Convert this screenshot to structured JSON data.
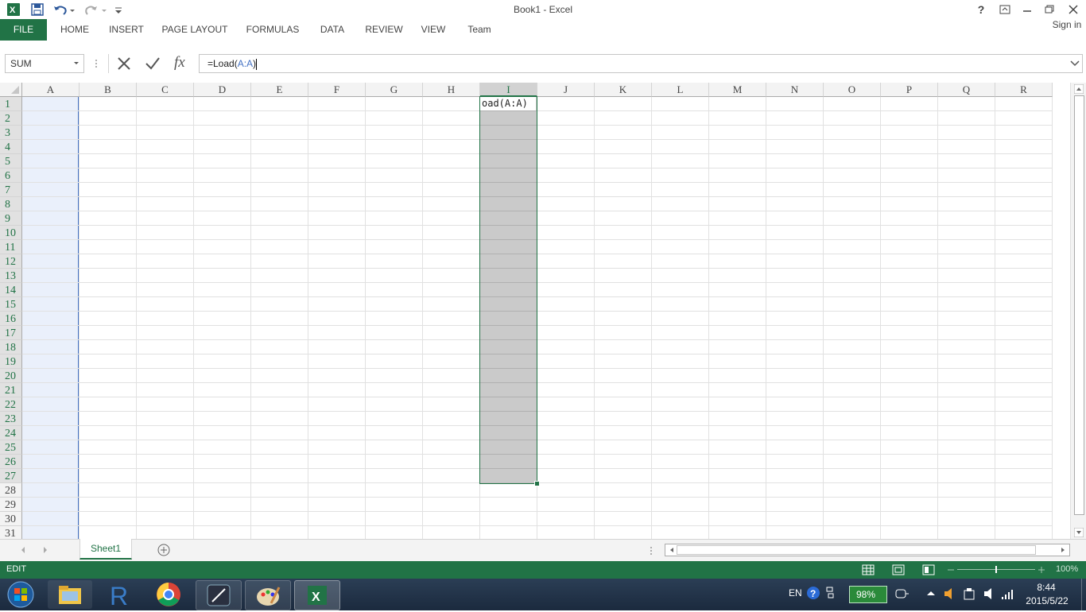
{
  "window": {
    "title": "Book1 - Excel",
    "help_label": "?",
    "sign_in": "Sign in"
  },
  "ribbon": {
    "tabs": [
      "FILE",
      "HOME",
      "INSERT",
      "PAGE LAYOUT",
      "FORMULAS",
      "DATA",
      "REVIEW",
      "VIEW",
      "Team"
    ]
  },
  "formula_bar": {
    "name_box": "SUM",
    "fx_label": "fx",
    "formula_prefix": "=Load(",
    "formula_ref": "A:A",
    "formula_suffix": ")"
  },
  "grid": {
    "columns": [
      "A",
      "B",
      "C",
      "D",
      "E",
      "F",
      "G",
      "H",
      "I",
      "J",
      "K",
      "L",
      "M",
      "N",
      "O",
      "P",
      "Q",
      "R"
    ],
    "rows": [
      "1",
      "2",
      "3",
      "4",
      "5",
      "6",
      "7",
      "8",
      "9",
      "10",
      "11",
      "12",
      "13",
      "14",
      "15",
      "16",
      "17",
      "18",
      "19",
      "20",
      "21",
      "22",
      "23",
      "24",
      "25",
      "26",
      "27",
      "28",
      "29",
      "30",
      "31"
    ],
    "selected_column": "I",
    "editing_cell_text": "oad(A:A)"
  },
  "sheets": {
    "tabs": [
      "Sheet1"
    ]
  },
  "status_bar": {
    "mode": "EDIT",
    "zoom": "100%"
  },
  "taskbar": {
    "language": "EN",
    "battery": "98%",
    "time": "8:44",
    "date": "2015/5/22"
  },
  "colors": {
    "accent": "#217346",
    "ref_blue": "#4472c4"
  }
}
